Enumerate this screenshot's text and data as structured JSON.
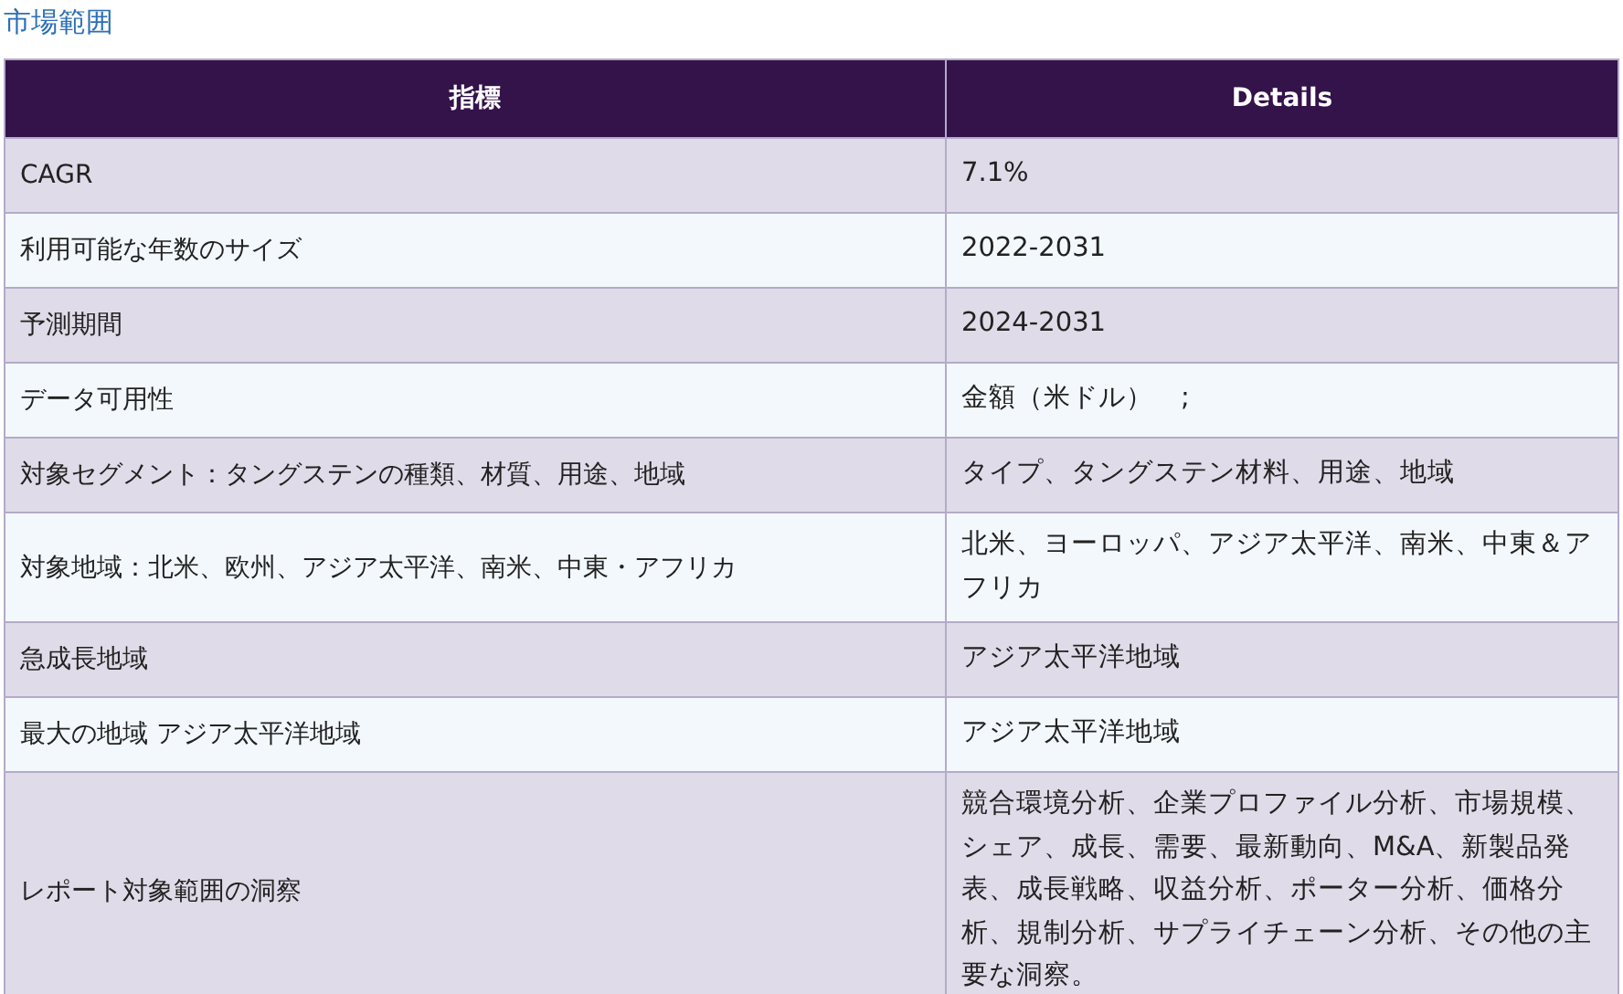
{
  "heading": "市場範囲",
  "table": {
    "columns": [
      "指標",
      "Details"
    ],
    "rows": [
      [
        "CAGR",
        "7.1%"
      ],
      [
        "利用可能な年数のサイズ",
        "2022-2031"
      ],
      [
        "予測期間",
        "2024-2031"
      ],
      [
        "データ可用性",
        "金額（米ドル）　;"
      ],
      [
        "対象セグメント：タングステンの種類、材質、用途、地域",
        "タイプ、タングステン材料、用途、地域"
      ],
      [
        "対象地域：北米、欧州、アジア太平洋、南米、中東・アフリカ",
        "北米、ヨーロッパ、アジア太平洋、南米、中東＆アフリカ"
      ],
      [
        "急成長地域",
        "アジア太平洋地域"
      ],
      [
        "最大の地域 アジア太平洋地域",
        "アジア太平洋地域"
      ],
      [
        "レポート対象範囲の洞察",
        "競合環境分析、企業プロファイル分析、市場規模、シェア、成長、需要、最新動向、M&A、新製品発表、成長戦略、収益分析、ポーター分析、価格分析、規制分析、サプライチェーン分析、その他の主要な洞察。"
      ]
    ]
  }
}
